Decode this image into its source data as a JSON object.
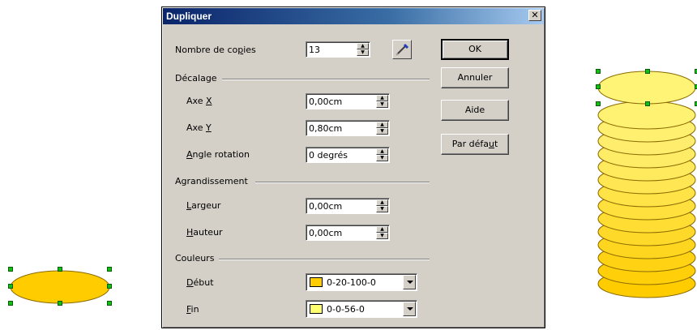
{
  "dialog": {
    "title": "Dupliquer",
    "close_label": "✕",
    "copies": {
      "label_pre": "Nombre de co",
      "label_u": "p",
      "label_post": "ies",
      "value": "13"
    },
    "offset": {
      "section": "Décalage",
      "x": {
        "label_pre": "Axe ",
        "label_u": "X",
        "label_post": "",
        "value": "0,00cm"
      },
      "y": {
        "label_pre": "Axe ",
        "label_u": "Y",
        "label_post": "",
        "value": "0,80cm"
      },
      "angle": {
        "label_pre": "",
        "label_u": "A",
        "label_post": "ngle rotation",
        "value": "0 degrés"
      }
    },
    "enlargement": {
      "section": "Agrandissement",
      "width": {
        "label_pre": "",
        "label_u": "L",
        "label_post": "argeur",
        "value": "0,00cm"
      },
      "height": {
        "label_pre": "",
        "label_u": "H",
        "label_post": "auteur",
        "value": "0,00cm"
      }
    },
    "colors": {
      "section": "Couleurs",
      "start": {
        "label_pre": "",
        "label_u": "D",
        "label_post": "ébut",
        "value": "0-20-100-0",
        "swatch": "#ffcc00"
      },
      "end": {
        "label_pre": "",
        "label_u": "F",
        "label_post": "in",
        "value": "0-0-56-0",
        "swatch": "#ffff70"
      }
    },
    "buttons": {
      "ok": "OK",
      "cancel": "Annuler",
      "help": "Aide",
      "default_pre": "Par défa",
      "default_u": "u",
      "default_post": "t"
    }
  },
  "colors": {
    "shape_fill": "#ffcc00",
    "shape_light": "#fff070",
    "shape_border": "#cc9900",
    "handle": "#10c010"
  }
}
